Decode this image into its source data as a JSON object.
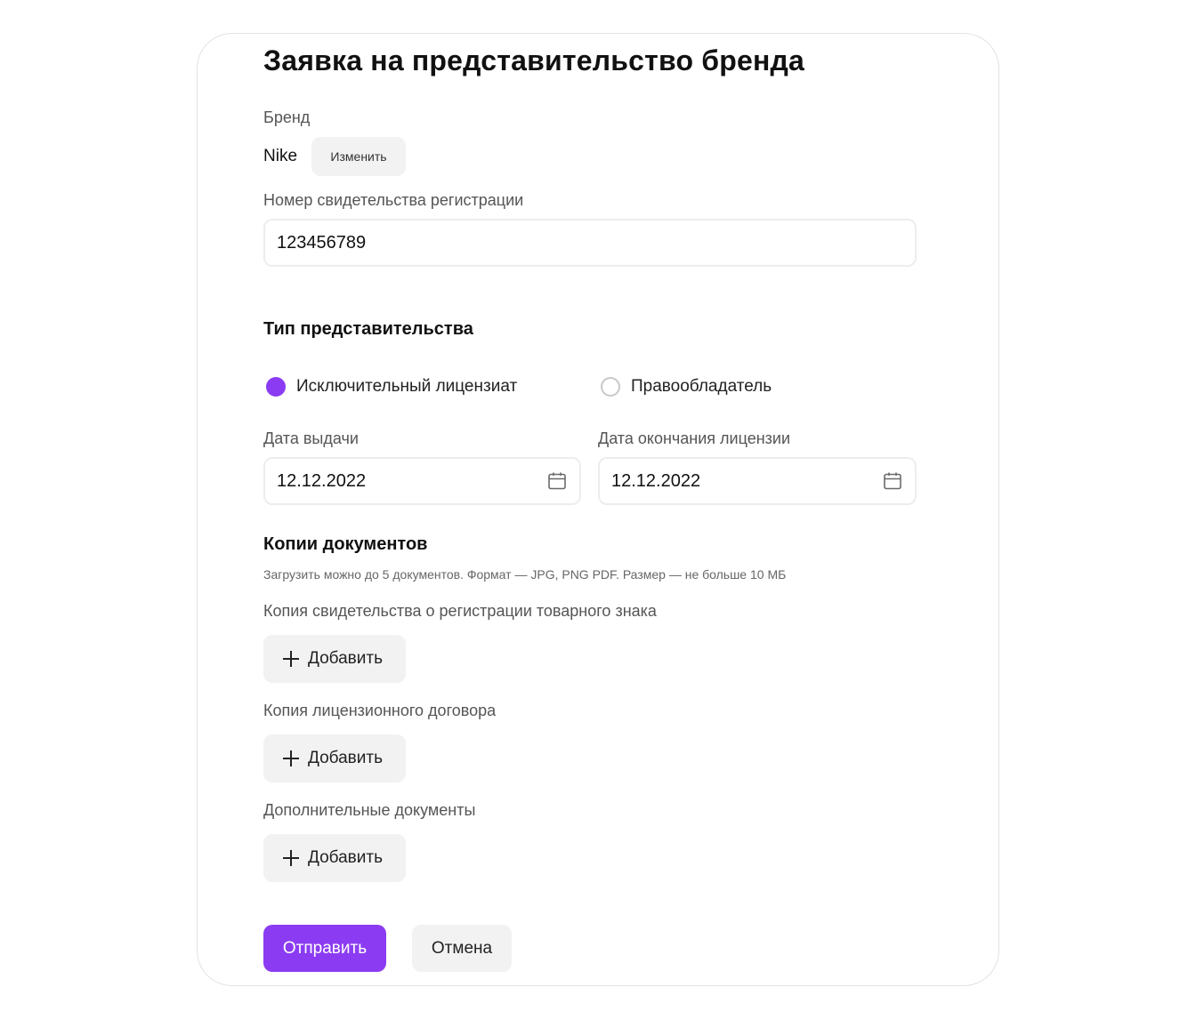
{
  "form": {
    "title": "Заявка на представительство бренда",
    "brand": {
      "label": "Бренд",
      "value": "Nike",
      "change_label": "Изменить"
    },
    "registration": {
      "label": "Номер свидетельства регистрации",
      "value": "123456789"
    },
    "representation": {
      "title": "Тип представительства",
      "options": [
        {
          "label": "Исключительный лицензиат",
          "selected": true
        },
        {
          "label": "Правообладатель",
          "selected": false
        }
      ]
    },
    "dates": {
      "issue": {
        "label": "Дата выдачи",
        "value": "12.12.2022",
        "icon": "calendar-icon"
      },
      "expiry": {
        "label": "Дата окончания лицензии",
        "value": "12.12.2022",
        "icon": "calendar-icon"
      }
    },
    "documents": {
      "title": "Копии документов",
      "hint": "Загрузить можно до 5 документов. Формат — JPG, PNG PDF. Размер — не больше 10 МБ",
      "groups": [
        {
          "label": "Копия свидетельства о регистрации товарного знака",
          "button": "Добавить"
        },
        {
          "label": "Копия лицензионного договора",
          "button": "Добавить"
        },
        {
          "label": "Дополнительные документы",
          "button": "Добавить"
        }
      ]
    },
    "actions": {
      "submit": "Отправить",
      "cancel": "Отмена"
    }
  },
  "colors": {
    "accent": "#8b3cf2",
    "chip_bg": "#f2f2f2",
    "border": "#ededed"
  }
}
